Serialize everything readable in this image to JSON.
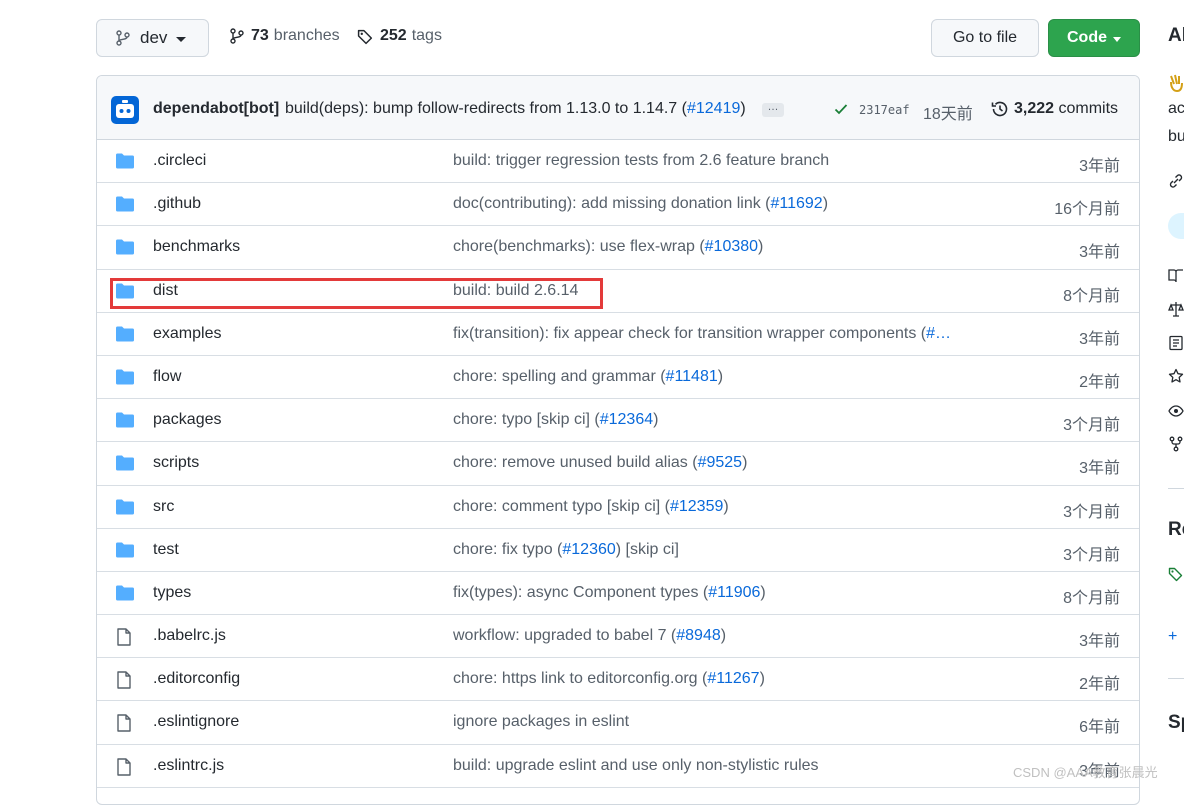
{
  "toolbar": {
    "branch": "dev",
    "branches_count": "73",
    "branches_label": "branches",
    "tags_count": "252",
    "tags_label": "tags",
    "goto_label": "Go to file",
    "code_label": "Code"
  },
  "commit": {
    "author": "dependabot[bot]",
    "message_prefix": "build(deps): bump follow-redirects from 1.13.0 to 1.14.7 (",
    "pr": "#12419",
    "message_suffix": ")",
    "ellipsis": "…",
    "sha": "2317eaf",
    "time": "18天前",
    "count": "3,222",
    "count_label": "commits"
  },
  "files": [
    {
      "name": ".circleci",
      "type": "dir",
      "msg": "build: trigger regression tests from 2.6 feature branch",
      "pr": "",
      "msg_after": "",
      "age": "3年前"
    },
    {
      "name": ".github",
      "type": "dir",
      "msg": "doc(contributing): add missing donation link (",
      "pr": "#11692",
      "msg_after": ")",
      "age": "16个月前"
    },
    {
      "name": "benchmarks",
      "type": "dir",
      "msg": "chore(benchmarks): use flex-wrap (",
      "pr": "#10380",
      "msg_after": ")",
      "age": "3年前"
    },
    {
      "name": "dist",
      "type": "dir",
      "msg": "build: build 2.6.14",
      "pr": "",
      "msg_after": "",
      "age": "8个月前"
    },
    {
      "name": "examples",
      "type": "dir",
      "msg": "fix(transition): fix appear check for transition wrapper components (",
      "pr": "#…",
      "msg_after": "",
      "age": "3年前"
    },
    {
      "name": "flow",
      "type": "dir",
      "msg": "chore: spelling and grammar (",
      "pr": "#11481",
      "msg_after": ")",
      "age": "2年前"
    },
    {
      "name": "packages",
      "type": "dir",
      "msg": "chore: typo [skip ci] (",
      "pr": "#12364",
      "msg_after": ")",
      "age": "3个月前"
    },
    {
      "name": "scripts",
      "type": "dir",
      "msg": "chore: remove unused build alias (",
      "pr": "#9525",
      "msg_after": ")",
      "age": "3年前"
    },
    {
      "name": "src",
      "type": "dir",
      "msg": "chore: comment typo [skip ci] (",
      "pr": "#12359",
      "msg_after": ")",
      "age": "3个月前"
    },
    {
      "name": "test",
      "type": "dir",
      "msg": "chore: fix typo (",
      "pr": "#12360",
      "msg_after": ") [skip ci]",
      "age": "3个月前"
    },
    {
      "name": "types",
      "type": "dir",
      "msg": "fix(types): async Component types (",
      "pr": "#11906",
      "msg_after": ")",
      "age": "8个月前"
    },
    {
      "name": ".babelrc.js",
      "type": "file",
      "msg": "workflow: upgraded to babel 7 (",
      "pr": "#8948",
      "msg_after": ")",
      "age": "3年前"
    },
    {
      "name": ".editorconfig",
      "type": "file",
      "msg": "chore: https link to editorconfig.org (",
      "pr": "#11267",
      "msg_after": ")",
      "age": "2年前"
    },
    {
      "name": ".eslintignore",
      "type": "file",
      "msg": "ignore packages in eslint",
      "pr": "",
      "msg_after": "",
      "age": "6年前"
    },
    {
      "name": ".eslintrc.js",
      "type": "file",
      "msg": "build: upgrade eslint and use only non-stylistic rules",
      "pr": "",
      "msg_after": "",
      "age": "3年前"
    }
  ],
  "sidebar": {
    "about_head": "Al",
    "desc1": "ac",
    "desc2": "bu",
    "releases_head": "Re",
    "plus": "+",
    "sponsors_head": "Sp"
  },
  "watermark": "CSDN @AAA教育张晨光",
  "colors": {
    "accent": "#0969da",
    "code_button": "#2da44e",
    "folder": "#54aeff",
    "highlight": "#e33a3a"
  }
}
